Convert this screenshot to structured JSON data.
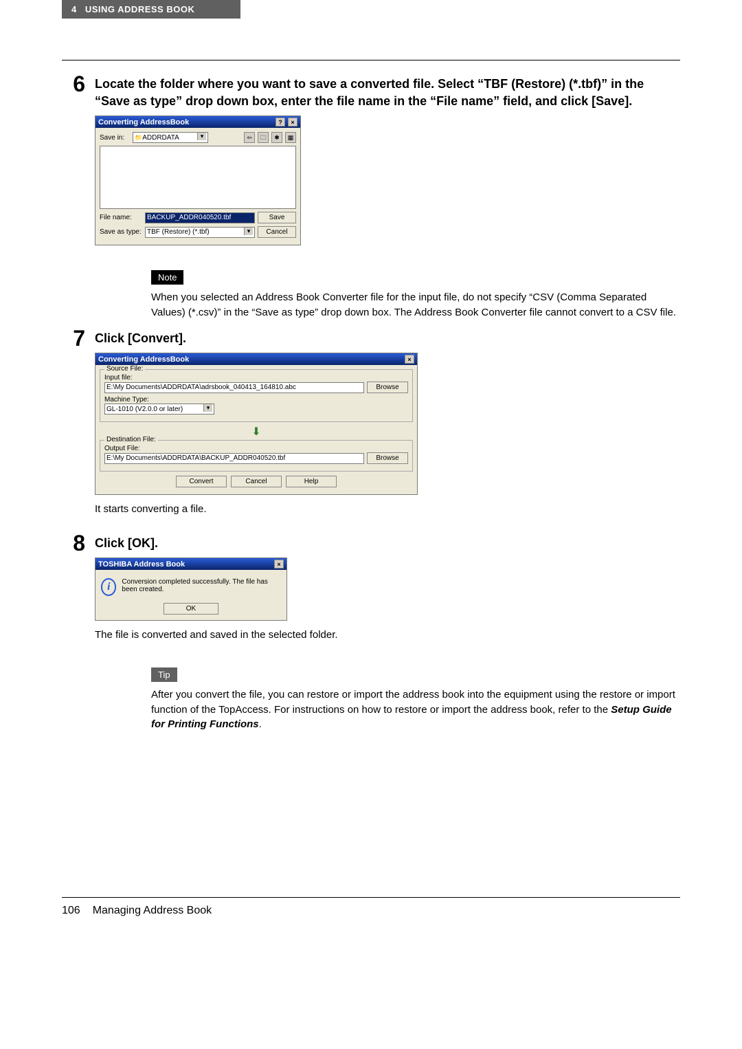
{
  "header": {
    "chapter_num": "4",
    "chapter_title": "USING ADDRESS BOOK"
  },
  "step6": {
    "num": "6",
    "heading": "Locate the folder where you want to save a converted file. Select “TBF (Restore) (*.tbf)” in the “Save as type” drop down box, enter the file name in the “File name” field, and click [Save]."
  },
  "dlg_save": {
    "title": "Converting AddressBook",
    "help_btn": "?",
    "close_btn": "×",
    "save_in_label": "Save in:",
    "save_in_value": "ADDRDATA",
    "filename_label": "File name:",
    "filename_value": "BACKUP_ADDR040520.tbf",
    "savetype_label": "Save as type:",
    "savetype_value": "TBF (Restore) (*.tbf)",
    "save_btn": "Save",
    "cancel_btn": "Cancel"
  },
  "note": {
    "badge": "Note",
    "text": "When you selected an Address Book Converter file for the input file, do not specify “CSV (Comma Separated Values) (*.csv)” in the “Save as type” drop down box. The Address Book Converter file cannot convert to a CSV file."
  },
  "step7": {
    "num": "7",
    "heading": "Click [Convert]."
  },
  "dlg_conv": {
    "title": "Converting AddressBook",
    "close_btn": "×",
    "src_legend": "Source File:",
    "input_label": "Input file:",
    "input_value": "E:\\My Documents\\ADDRDATA\\adrsbook_040413_164810.abc",
    "machine_label": "Machine Type:",
    "machine_value": "GL-1010 (V2.0.0 or later)",
    "dst_legend": "Destination File:",
    "output_label": "Output File:",
    "output_value": "E:\\My Documents\\ADDRDATA\\BACKUP_ADDR040520.tbf",
    "browse_btn": "Browse",
    "convert_btn": "Convert",
    "cancel_btn": "Cancel",
    "help_btn": "Help",
    "after": "It starts converting a file."
  },
  "step8": {
    "num": "8",
    "heading": "Click [OK]."
  },
  "dlg_ok": {
    "title": "TOSHIBA Address Book",
    "close_btn": "×",
    "msg": "Conversion completed successfully. The file has been created.",
    "ok_btn": "OK",
    "after": "The file is converted and saved in the selected folder."
  },
  "tip": {
    "badge": "Tip",
    "text_pre": "After you convert the file, you can restore or import the address book into the equipment using the restore or import function of the TopAccess. For instructions on how to restore or import the address book, refer to the ",
    "text_em": "Setup Guide for Printing Functions",
    "text_post": "."
  },
  "footer": {
    "page": "106",
    "section": "Managing Address Book"
  }
}
